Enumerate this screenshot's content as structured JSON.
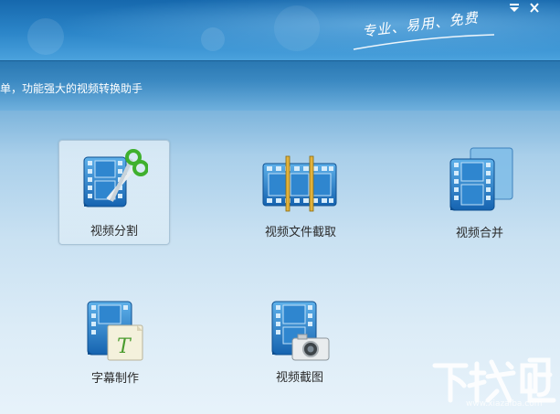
{
  "header": {
    "slogan": "专业、易用、免费",
    "menu_icon": "menu-arrow-icon",
    "close_icon": "close-icon"
  },
  "subbar": {
    "subtitle": "单，功能强大的视频转换助手"
  },
  "tools": [
    {
      "label": "视频分割",
      "icon": "film-scissors-icon",
      "selected": true
    },
    {
      "label": "视频文件截取",
      "icon": "film-clip-icon",
      "selected": false
    },
    {
      "label": "视频合并",
      "icon": "film-merge-icon",
      "selected": false
    },
    {
      "label": "字幕制作",
      "icon": "film-subtitle-icon",
      "selected": false
    },
    {
      "label": "视频截图",
      "icon": "film-camera-icon",
      "selected": false
    }
  ],
  "watermark": {
    "text": "下载吧",
    "url": "www.xiazaiba.com"
  },
  "colors": {
    "header_blue": "#1f7cc0",
    "film_blue": "#1e74c0",
    "label_text": "#2b2b2b"
  }
}
